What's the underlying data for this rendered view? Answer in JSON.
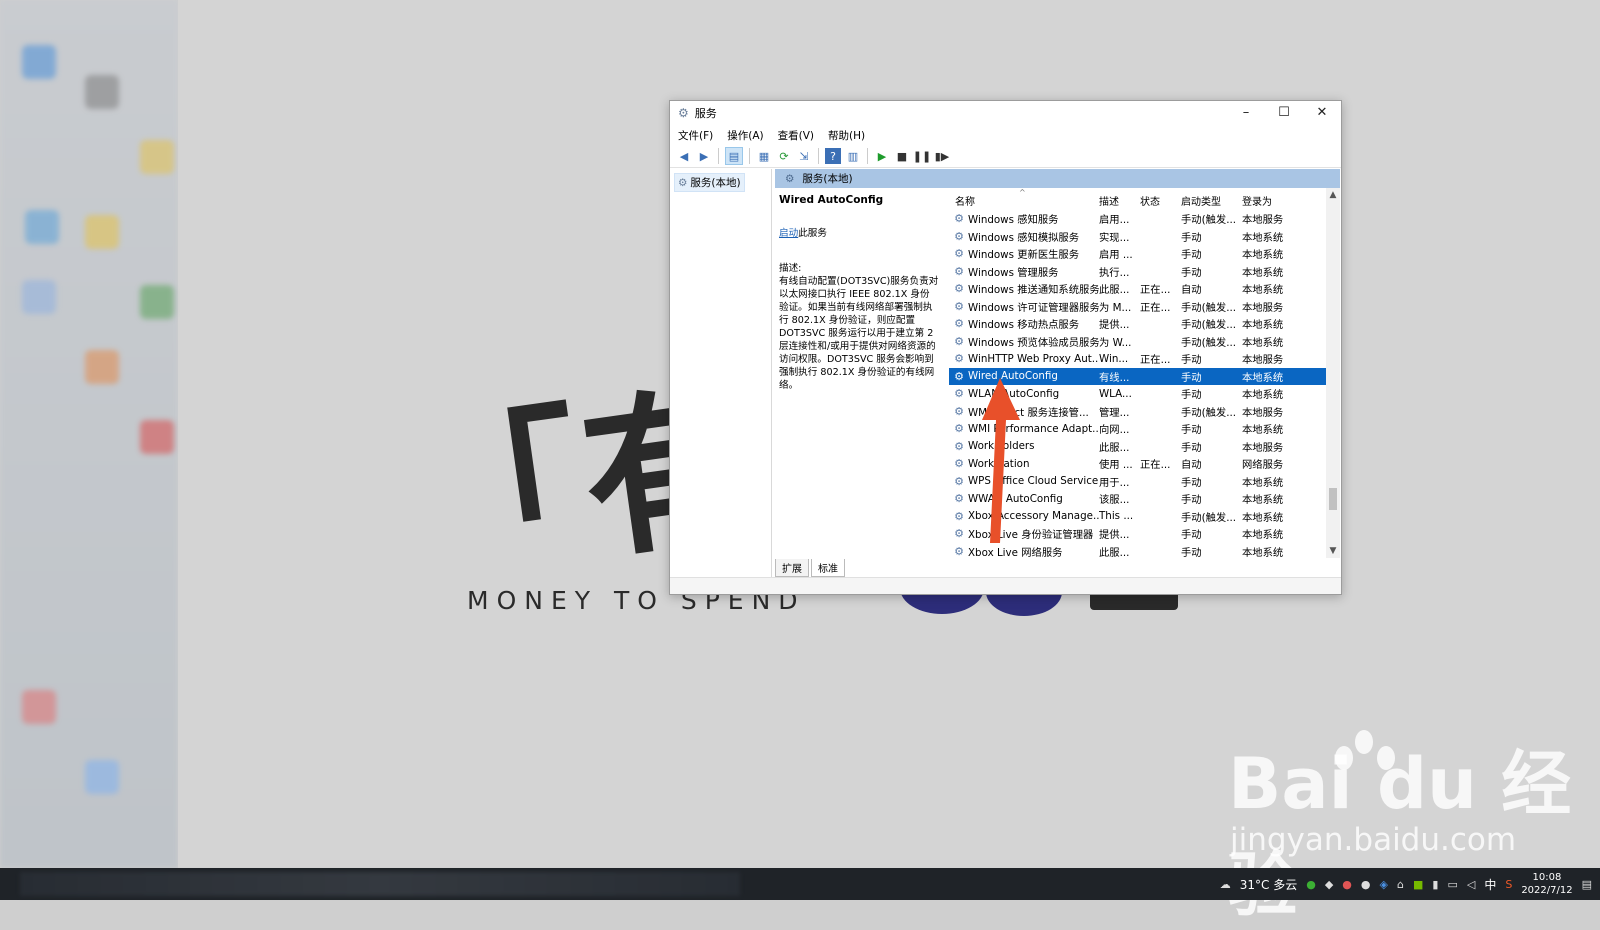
{
  "window": {
    "title": "服务",
    "controls": {
      "minimize": "–",
      "maximize": "☐",
      "close": "✕"
    },
    "menu": [
      "文件(F)",
      "操作(A)",
      "查看(V)",
      "帮助(H)"
    ],
    "tree_item": "服务(本地)",
    "header": "服务(本地)",
    "detail": {
      "service_name": "Wired AutoConfig",
      "start_link": "启动",
      "start_suffix": "此服务",
      "desc_label": "描述:",
      "description": "有线自动配置(DOT3SVC)服务负责对以太网接口执行 IEEE 802.1X 身份验证。如果当前有线网络部署强制执行 802.1X 身份验证，则应配置 DOT3SVC 服务运行以用于建立第 2 层连接性和/或用于提供对网络资源的访问权限。DOT3SVC 服务会影响到强制执行 802.1X 身份验证的有线网络。"
    },
    "columns": {
      "name": "名称",
      "desc": "描述",
      "status": "状态",
      "startup": "启动类型",
      "logon": "登录为"
    },
    "rows": [
      {
        "name": "Windows 感知服务",
        "desc": "启用...",
        "status": "",
        "startup": "手动(触发...",
        "logon": "本地服务"
      },
      {
        "name": "Windows 感知模拟服务",
        "desc": "实现...",
        "status": "",
        "startup": "手动",
        "logon": "本地系统"
      },
      {
        "name": "Windows 更新医生服务",
        "desc": "启用 ...",
        "status": "",
        "startup": "手动",
        "logon": "本地系统"
      },
      {
        "name": "Windows 管理服务",
        "desc": "执行...",
        "status": "",
        "startup": "手动",
        "logon": "本地系统"
      },
      {
        "name": "Windows 推送通知系统服务",
        "desc": "此服...",
        "status": "正在...",
        "startup": "自动",
        "logon": "本地系统"
      },
      {
        "name": "Windows 许可证管理器服务",
        "desc": "为 M...",
        "status": "正在...",
        "startup": "手动(触发...",
        "logon": "本地服务"
      },
      {
        "name": "Windows 移动热点服务",
        "desc": "提供...",
        "status": "",
        "startup": "手动(触发...",
        "logon": "本地系统"
      },
      {
        "name": "Windows 预览体验成员服务",
        "desc": "为 W...",
        "status": "",
        "startup": "手动(触发...",
        "logon": "本地系统"
      },
      {
        "name": "WinHTTP Web Proxy Aut...",
        "desc": "Win...",
        "status": "正在...",
        "startup": "手动",
        "logon": "本地服务"
      },
      {
        "name": "Wired AutoConfig",
        "desc": "有线...",
        "status": "",
        "startup": "手动",
        "logon": "本地系统",
        "selected": true
      },
      {
        "name": "WLAN AutoConfig",
        "desc": "WLA...",
        "status": "",
        "startup": "手动",
        "logon": "本地系统"
      },
      {
        "name": "WMI Direct 服务连接管...",
        "desc": "管理...",
        "status": "",
        "startup": "手动(触发...",
        "logon": "本地服务"
      },
      {
        "name": "WMI Performance Adapt...",
        "desc": "向网...",
        "status": "",
        "startup": "手动",
        "logon": "本地系统"
      },
      {
        "name": "Work Folders",
        "desc": "此服...",
        "status": "",
        "startup": "手动",
        "logon": "本地服务"
      },
      {
        "name": "Workstation",
        "desc": "使用 ...",
        "status": "正在...",
        "startup": "自动",
        "logon": "网络服务"
      },
      {
        "name": "WPS Office Cloud Service",
        "desc": "用于...",
        "status": "",
        "startup": "手动",
        "logon": "本地系统"
      },
      {
        "name": "WWAN AutoConfig",
        "desc": "该服...",
        "status": "",
        "startup": "手动",
        "logon": "本地系统"
      },
      {
        "name": "Xbox Accessory Manage...",
        "desc": "This ...",
        "status": "",
        "startup": "手动(触发...",
        "logon": "本地系统"
      },
      {
        "name": "Xbox Live 身份验证管理器",
        "desc": "提供...",
        "status": "",
        "startup": "手动",
        "logon": "本地系统"
      },
      {
        "name": "Xbox Live 网络服务",
        "desc": "此服...",
        "status": "",
        "startup": "手动",
        "logon": "本地系统"
      }
    ],
    "tabs": [
      "扩展",
      "标准"
    ],
    "selection_color": "#0a66c2",
    "header_color": "#a9c5e4"
  },
  "wallpaper": {
    "logo_text": "「有钱",
    "tagline": "MONEY TO SPEND"
  },
  "watermark": {
    "brand": "Bai du 经验",
    "url": "jingyan.baidu.com"
  },
  "taskbar": {
    "weather": "31°C 多云",
    "ime": "中",
    "time": "10:08",
    "date": "2022/7/12"
  },
  "annotation": {
    "arrow_color": "#e8502a"
  }
}
